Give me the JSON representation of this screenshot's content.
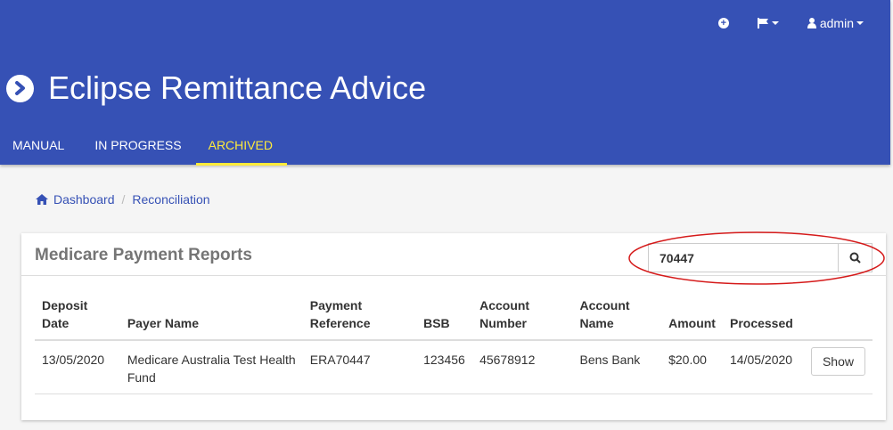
{
  "header": {
    "title": "Eclipse Remittance Advice",
    "user": "admin",
    "tabs": [
      {
        "label": "MANUAL",
        "active": false
      },
      {
        "label": "IN PROGRESS",
        "active": false
      },
      {
        "label": "ARCHIVED",
        "active": true
      }
    ],
    "colors": {
      "primary": "#3651b5",
      "active_tab": "#ffeb3b"
    }
  },
  "breadcrumb": {
    "items": [
      "Dashboard",
      "Reconciliation"
    ]
  },
  "panel": {
    "title": "Medicare Payment Reports",
    "search": {
      "value": "70447"
    },
    "columns": [
      "Deposit Date",
      "Payer Name",
      "Payment Reference",
      "BSB",
      "Account Number",
      "Account Name",
      "Amount",
      "Processed"
    ],
    "rows": [
      {
        "deposit_date": "13/05/2020",
        "payer_name": "Medicare Australia Test Health Fund",
        "payment_reference": "ERA70447",
        "bsb": "123456",
        "account_number": "45678912",
        "account_name": "Bens Bank",
        "amount": "$20.00",
        "processed": "14/05/2020",
        "action": "Show"
      }
    ]
  }
}
